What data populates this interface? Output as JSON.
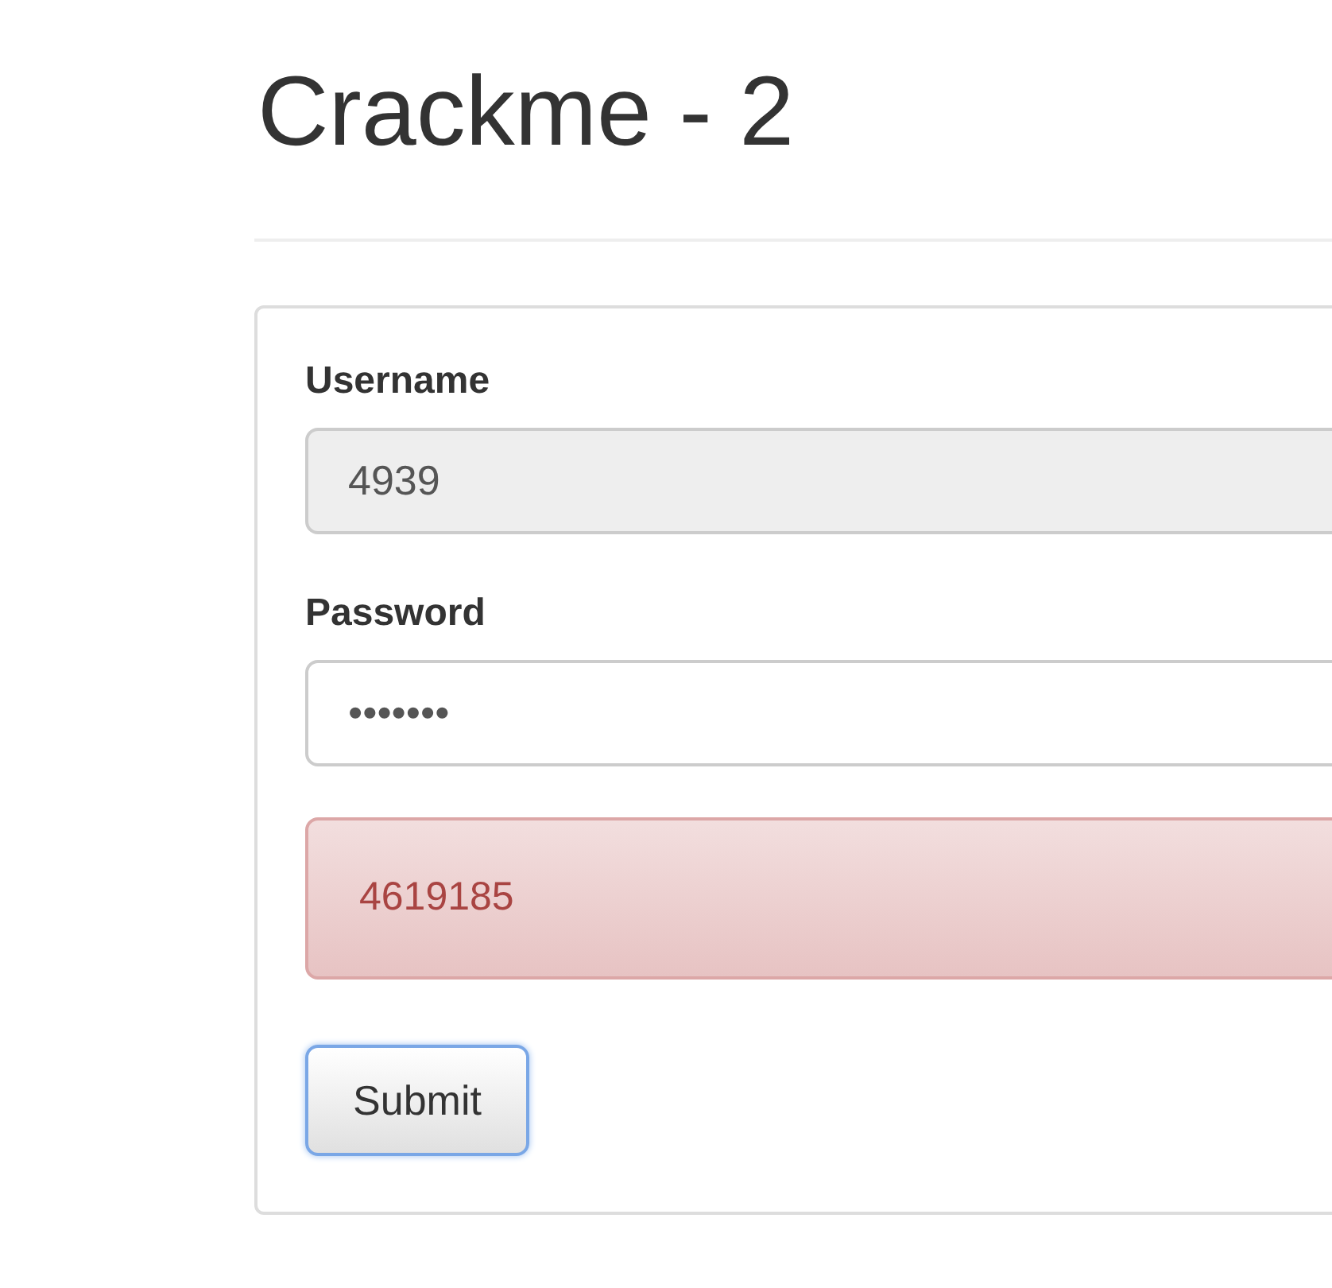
{
  "title": "Crackme - 2",
  "form": {
    "fields": [
      {
        "label": "Username",
        "value": "4939",
        "disabled": true
      },
      {
        "label": "Password",
        "value": "•••••••",
        "disabled": false
      }
    ],
    "alert": {
      "text": "4619185"
    },
    "submit": {
      "label": "Submit",
      "focused": true
    }
  }
}
